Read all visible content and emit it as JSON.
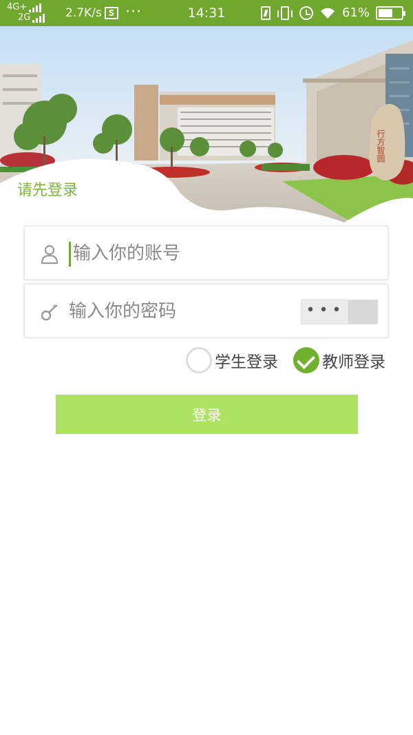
{
  "status_bar": {
    "network_top": "4G+",
    "network_bottom": "2G",
    "speed": "2.7K/s",
    "time": "14:31",
    "battery_percent": "61%",
    "battery_level": 0.61,
    "icons": [
      "signal-icon",
      "s-app-icon",
      "more-dots-icon",
      "battery-saver-icon",
      "vibrate-icon",
      "alarm-icon",
      "wifi-icon",
      "battery-icon"
    ]
  },
  "banner": {
    "welcome_text": "请先登录",
    "stone_text": "行方智圆"
  },
  "form": {
    "account_placeholder": "输入你的账号",
    "password_placeholder": "输入你的密码",
    "password_toggle_dots": "•••",
    "roles": [
      {
        "label": "学生登录",
        "selected": false
      },
      {
        "label": "教师登录",
        "selected": true
      }
    ],
    "login_button": "登录"
  },
  "colors": {
    "status_bar": "#6fa82c",
    "accent": "#7cb73a",
    "login_button": "#aee262",
    "radio_selected": "#6fb12d"
  }
}
